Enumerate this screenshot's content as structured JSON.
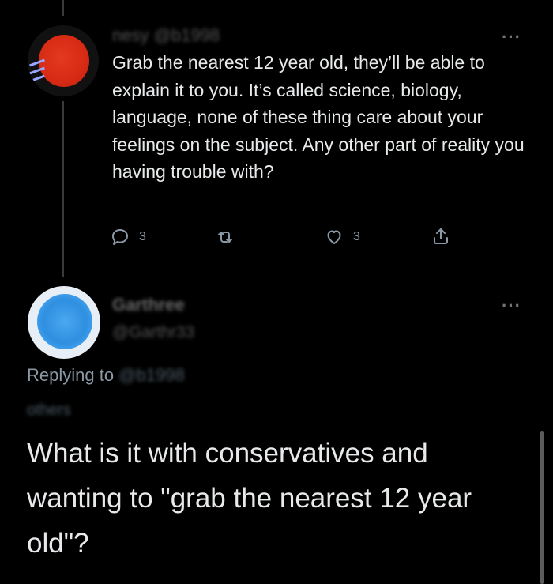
{
  "tweet1": {
    "handle_partial": "nesy @b1998",
    "text": "Grab the nearest 12 year old, they’ll be able to explain it to you. It’s called science, biology, language, none of these thing care about your feelings on the subject. Any other part of reality you having trouble with?",
    "actions": {
      "reply_count": "3",
      "like_count": "3"
    }
  },
  "tweet2": {
    "display_name": "Garthree",
    "handle": "@Garthr33",
    "replying_to_label": "Replying to",
    "replying_to_handle": "@b1998",
    "replying_to_others": "others",
    "text": "What is it with conservatives and wanting to \"grab the nearest 12 year old\"?"
  },
  "colors": {
    "background": "#000000",
    "text": "#e7e9ea",
    "muted": "#8b98a5"
  },
  "icons": [
    "reply-icon",
    "retweet-icon",
    "like-icon",
    "share-icon",
    "more-icon"
  ]
}
